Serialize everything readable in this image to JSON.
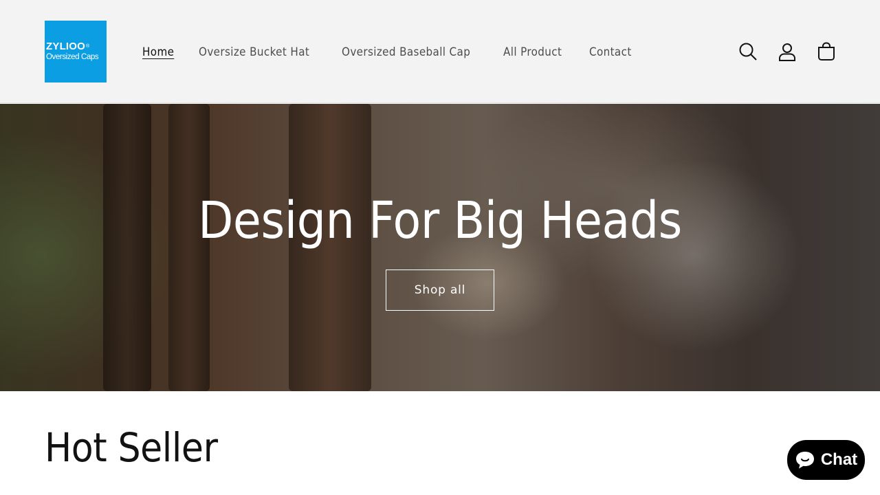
{
  "header": {
    "logo": {
      "brand": "ZYLIOO",
      "registered": "®",
      "tagline": "Oversized Caps"
    },
    "nav": [
      {
        "label": "Home",
        "active": true
      },
      {
        "label": "Oversize Bucket Hat",
        "active": false
      },
      {
        "label": "Oversized Baseball Cap",
        "active": false
      },
      {
        "label": "All Product",
        "active": false
      },
      {
        "label": "Contact",
        "active": false
      }
    ],
    "icons": [
      "search-icon",
      "account-icon",
      "cart-icon"
    ]
  },
  "hero": {
    "heading": "Design For Big Heads",
    "button_label": "Shop all"
  },
  "section": {
    "title": "Hot Seller"
  },
  "chat": {
    "label": "Chat",
    "icon": "chat-bubble-icon"
  },
  "colors": {
    "logo_bg": "#0b9ee3",
    "header_bg": "#f3f3f3",
    "text": "#121212",
    "chat_bg": "#000000"
  }
}
